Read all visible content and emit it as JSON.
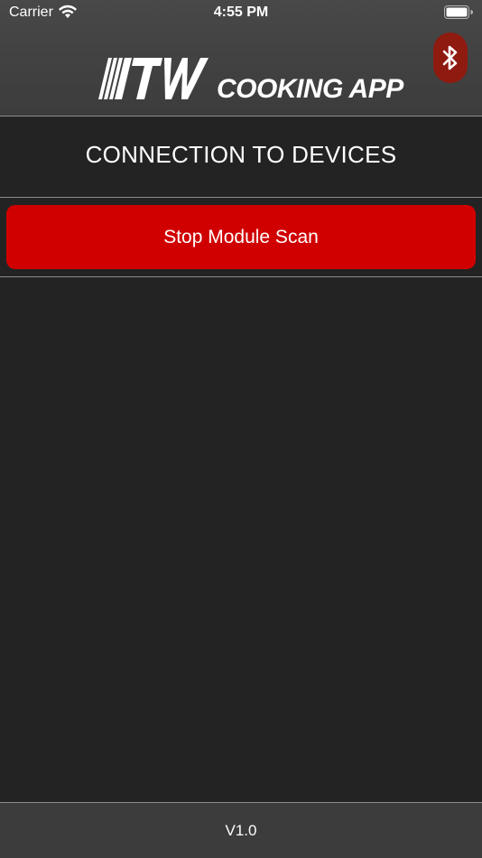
{
  "status_bar": {
    "carrier": "Carrier",
    "time": "4:55 PM",
    "wifi_icon": "wifi-icon",
    "battery_icon": "battery-icon"
  },
  "app_bar": {
    "logo_letters": "ITW",
    "logo_subtitle": "COOKING APP",
    "bluetooth_icon": "bluetooth-icon",
    "bluetooth_color": "#8f1a10"
  },
  "main": {
    "section_title": "CONNECTION TO DEVICES",
    "scan_button_label": "Stop Module Scan",
    "scan_button_color": "#d10000",
    "devices": []
  },
  "footer": {
    "version": "V1.0"
  }
}
